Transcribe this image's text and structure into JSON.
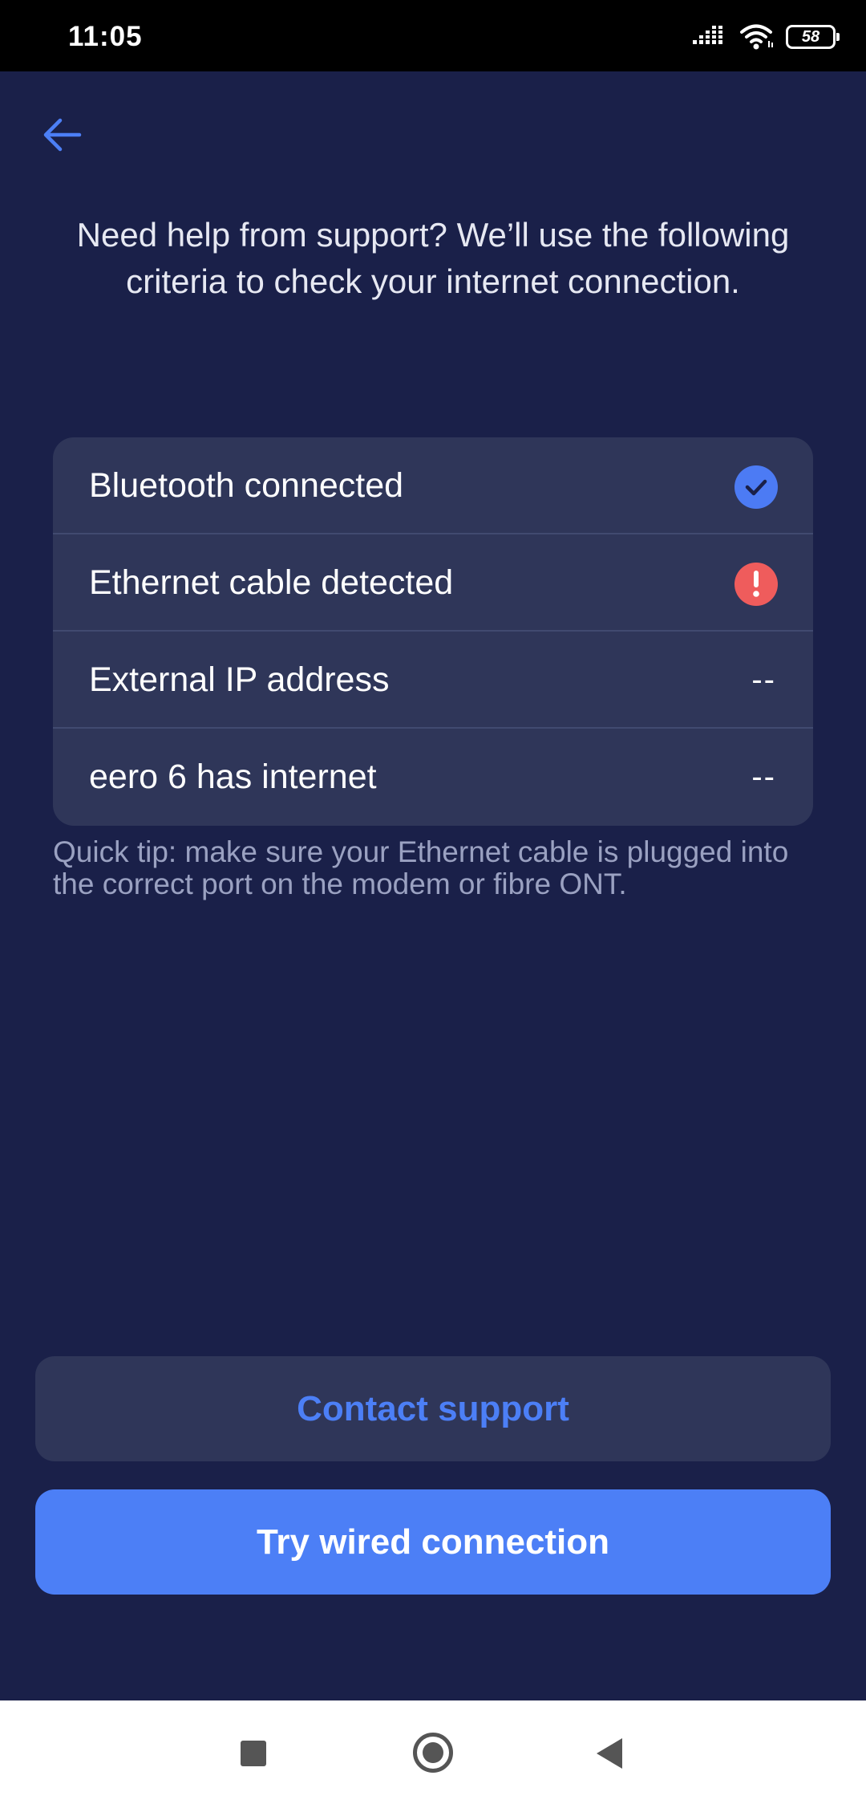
{
  "status_bar": {
    "time": "11:05",
    "battery": "58",
    "icons": [
      "signal-icon",
      "wifi-icon",
      "battery-icon"
    ]
  },
  "header": {
    "back_icon": "arrow-left-icon"
  },
  "intro": {
    "text": "Need help from support? We’ll use the following criteria to check your internet connection."
  },
  "criteria": {
    "items": [
      {
        "label": "Bluetooth connected",
        "status": "check",
        "status_icon": "check-circle-icon"
      },
      {
        "label": "Ethernet cable detected",
        "status": "alert",
        "status_icon": "alert-circle-icon"
      },
      {
        "label": "External IP address",
        "status": "--"
      },
      {
        "label": "eero 6 has internet",
        "status": "--"
      }
    ]
  },
  "tip": {
    "text": "Quick tip: make sure your Ethernet cable is plugged into the correct port on the modem or fibre ONT."
  },
  "buttons": {
    "contact_support": "Contact support",
    "try_wired": "Try wired connection"
  },
  "colors": {
    "background": "#1a2049",
    "card": "#2f3659",
    "accent": "#4c7ff6",
    "success": "#4c7bf4",
    "error": "#ef5c5c"
  },
  "nav_bar": {
    "icons": [
      "recent-apps-icon",
      "home-icon",
      "back-triangle-icon"
    ]
  }
}
